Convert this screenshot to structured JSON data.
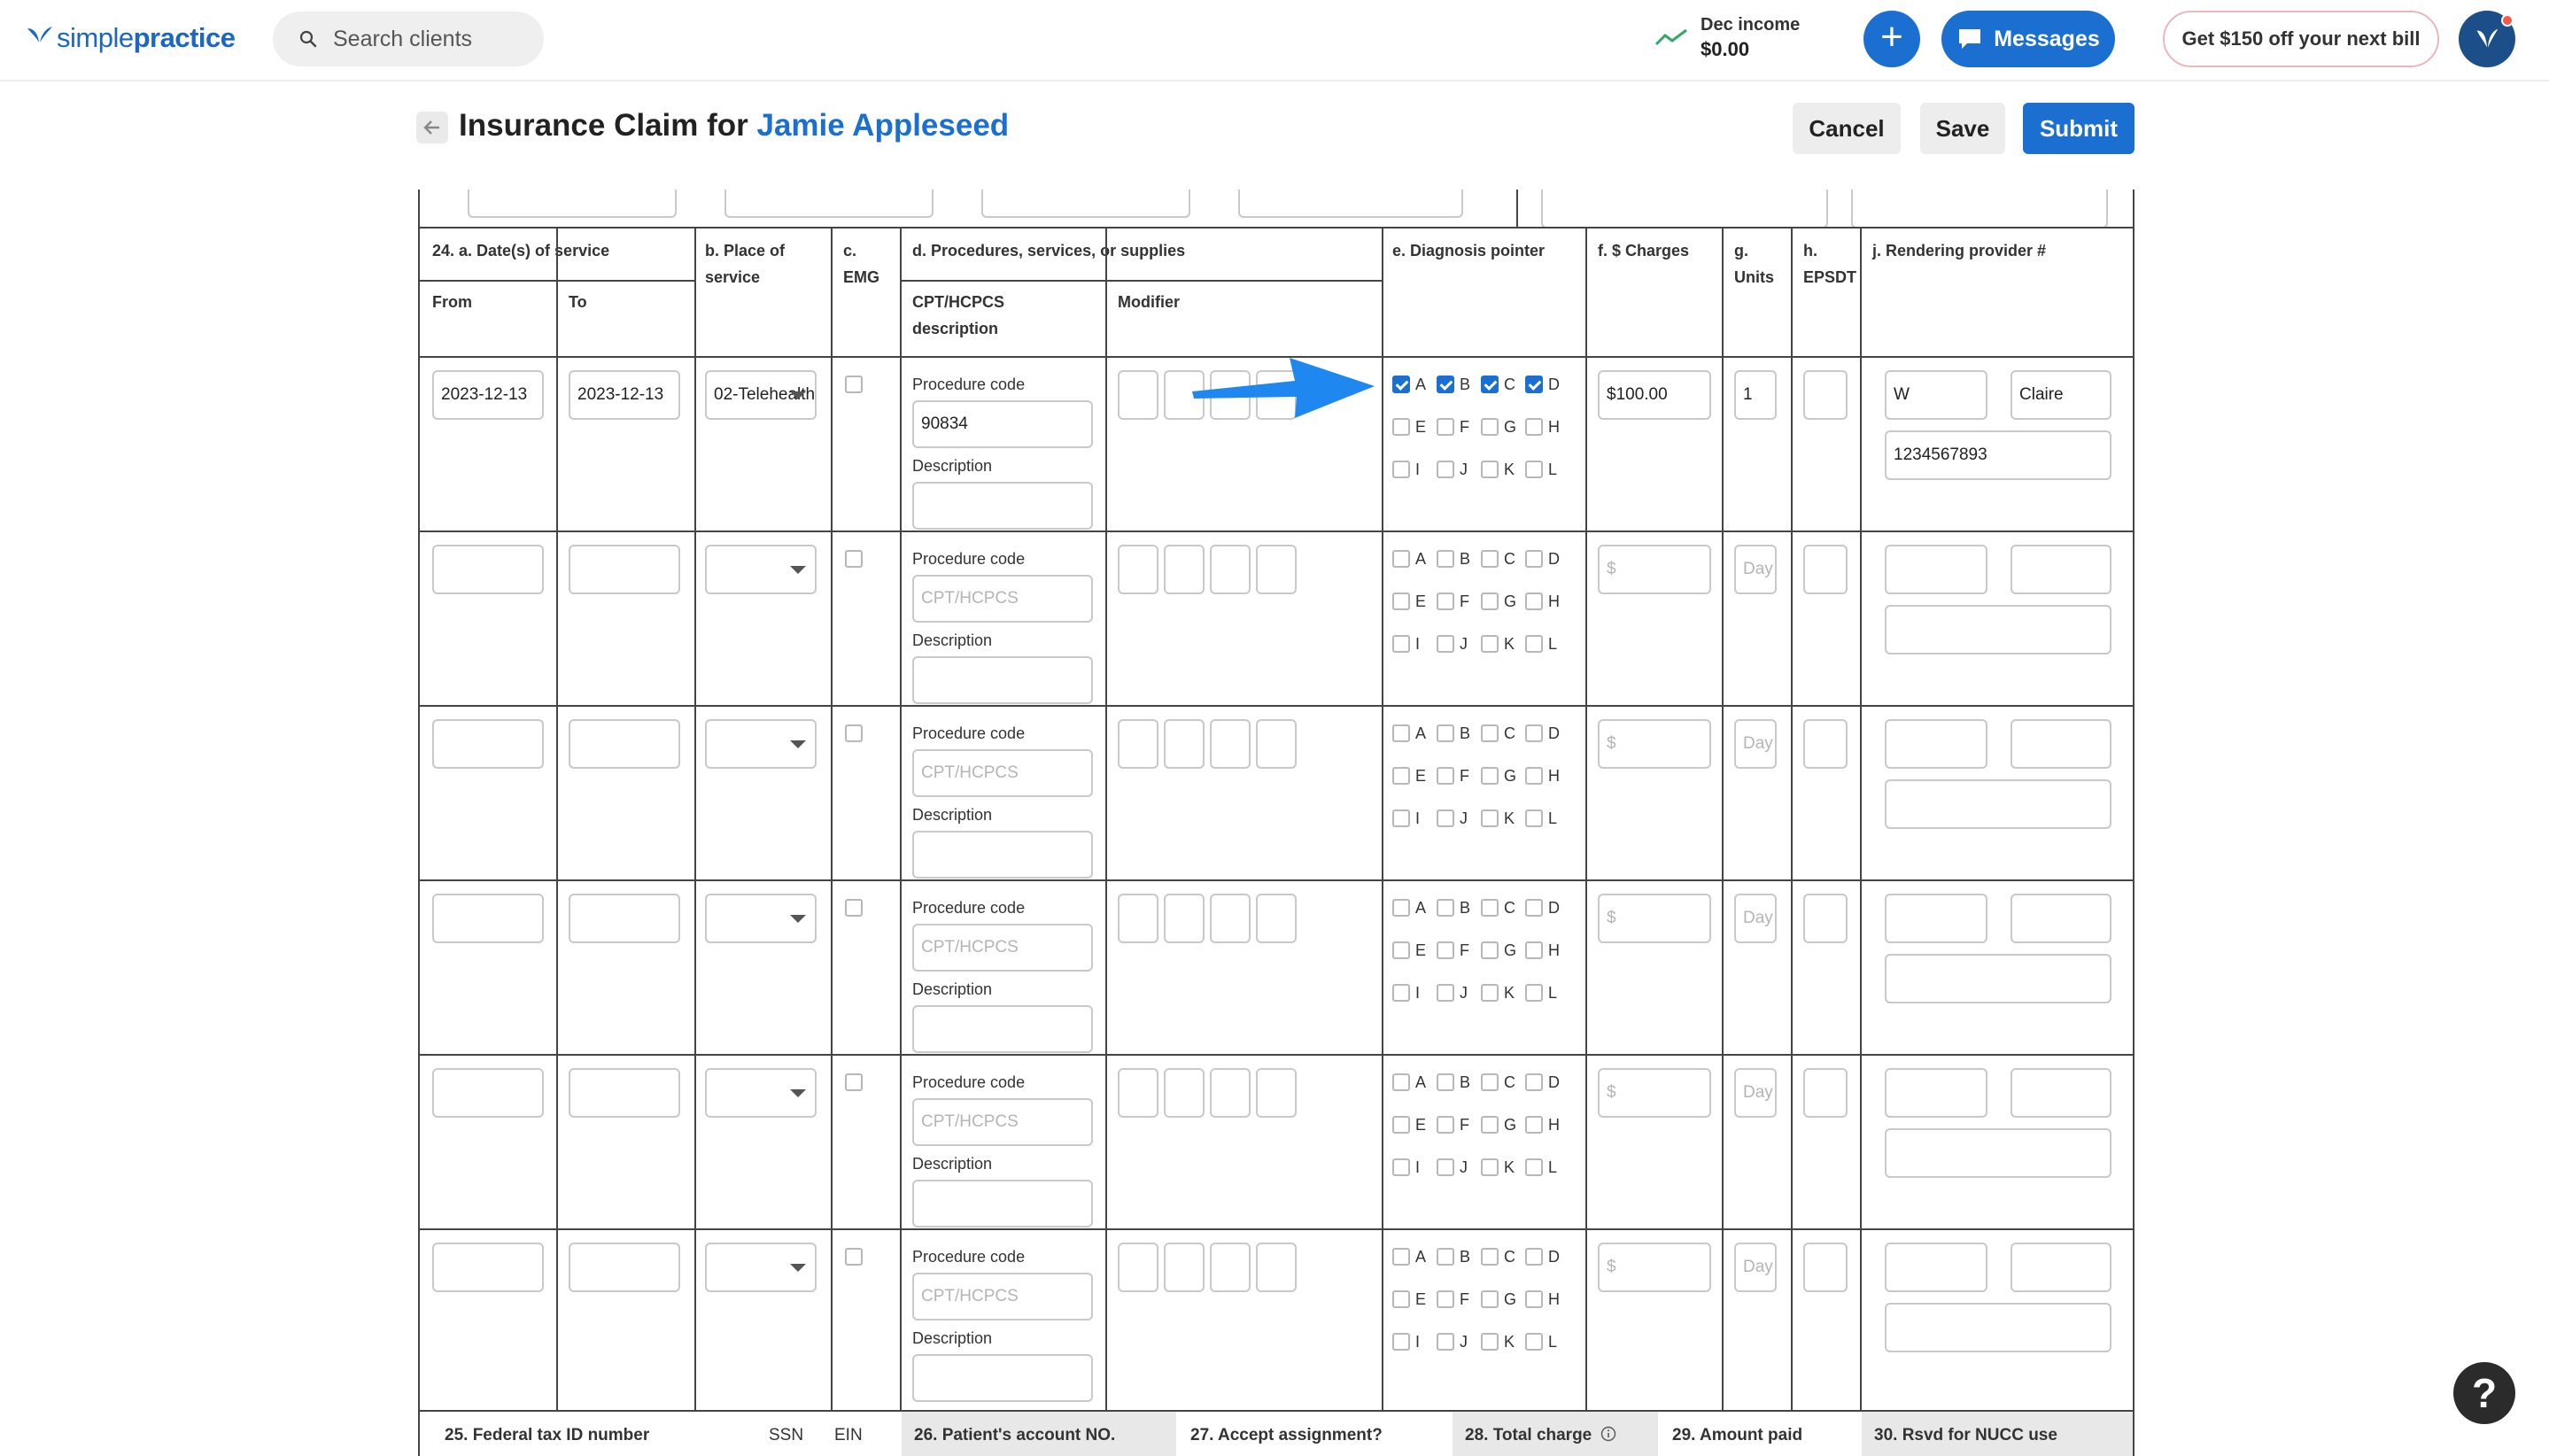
{
  "nav": {
    "logo_regular": "simple",
    "logo_bold": "practice",
    "search_placeholder": "Search clients",
    "income_label": "Dec income",
    "income_value": "$0.00",
    "plus_label": "+",
    "messages_label": "Messages",
    "promo_label": "Get $150 off your next bill"
  },
  "header": {
    "title_prefix": "Insurance Claim for",
    "client_name": "Jamie Appleseed",
    "cancel_label": "Cancel",
    "save_label": "Save",
    "submit_label": "Submit"
  },
  "table": {
    "col_24a": "24. a. Date(s) of service",
    "col_from": "From",
    "col_to": "To",
    "col_b": "b. Place of service",
    "col_c": "c. EMG",
    "col_d": "d. Procedures, services, or supplies",
    "col_cpt": "CPT/HCPCS description",
    "col_modifier": "Modifier",
    "col_e": "e. Diagnosis pointer",
    "col_f": "f. $ Charges",
    "col_g": "g. Units",
    "col_h": "h. EPSDT",
    "col_j": "j. Rendering provider #",
    "procedure_code_label": "Procedure code",
    "description_label": "Description",
    "cpt_placeholder": "CPT/HCPCS",
    "charge_placeholder": "$",
    "units_placeholder": "Day",
    "pointer_letters": [
      "A",
      "B",
      "C",
      "D",
      "E",
      "F",
      "G",
      "H",
      "I",
      "J",
      "K",
      "L"
    ],
    "rows": [
      {
        "from": "2023-12-13",
        "to": "2023-12-13",
        "place": "02-Telehealth",
        "procedure_code": "90834",
        "charges": "$100.00",
        "units": "1",
        "provider_first": "W",
        "provider_last": "Claire",
        "provider_npi": "1234567893",
        "checked": [
          "A",
          "B",
          "C",
          "D"
        ]
      },
      {
        "from": "",
        "to": "",
        "place": "",
        "procedure_code": "",
        "charges": "",
        "units": "",
        "provider_first": "",
        "provider_last": "",
        "provider_npi": "",
        "checked": []
      },
      {
        "from": "",
        "to": "",
        "place": "",
        "procedure_code": "",
        "charges": "",
        "units": "",
        "provider_first": "",
        "provider_last": "",
        "provider_npi": "",
        "checked": []
      },
      {
        "from": "",
        "to": "",
        "place": "",
        "procedure_code": "",
        "charges": "",
        "units": "",
        "provider_first": "",
        "provider_last": "",
        "provider_npi": "",
        "checked": []
      },
      {
        "from": "",
        "to": "",
        "place": "",
        "procedure_code": "",
        "charges": "",
        "units": "",
        "provider_first": "",
        "provider_last": "",
        "provider_npi": "",
        "checked": []
      },
      {
        "from": "",
        "to": "",
        "place": "",
        "procedure_code": "",
        "charges": "",
        "units": "",
        "provider_first": "",
        "provider_last": "",
        "provider_npi": "",
        "checked": []
      }
    ]
  },
  "footer": {
    "f25": "25. Federal tax ID number",
    "ssn": "SSN",
    "ein": "EIN",
    "f26": "26. Patient's account NO.",
    "f27": "27. Accept assignment?",
    "f28": "28. Total charge",
    "f29": "29. Amount paid",
    "f30": "30. Rsvd for NUCC use"
  },
  "help_label": "?",
  "colors": {
    "accent": "#1b6fd1",
    "arrow": "#1e88f0",
    "grid": "#444444"
  }
}
